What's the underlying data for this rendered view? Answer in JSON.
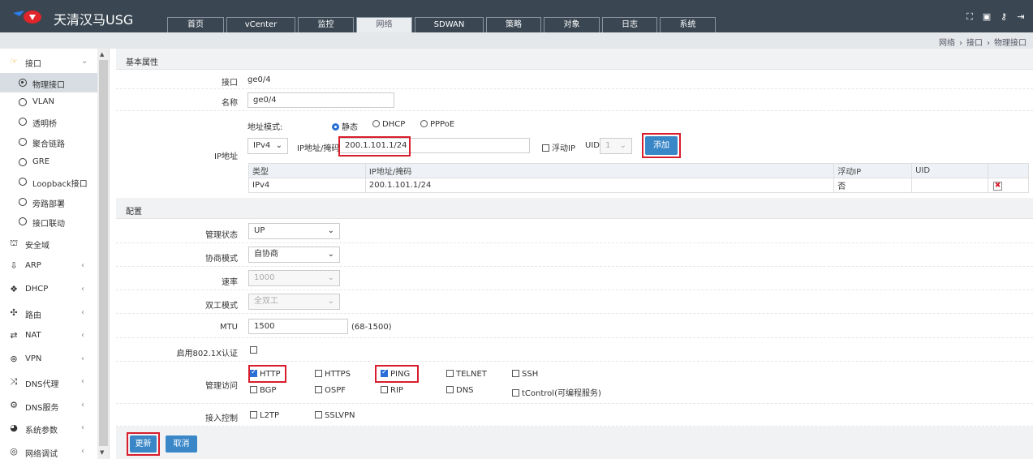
{
  "app": {
    "title": "天清汉马USG"
  },
  "main_tabs": [
    "首页",
    "vCenter",
    "监控",
    "网络",
    "SDWAN",
    "策略",
    "对象",
    "日志",
    "系统"
  ],
  "active_tab": "网络",
  "breadcrumb": [
    "网络",
    "接口",
    "物理接口"
  ],
  "sidebar": {
    "interface_group": "接口",
    "sub_items": [
      "物理接口",
      "VLAN",
      "透明桥",
      "聚合链路",
      "GRE",
      "Loopback接口",
      "旁路部署",
      "接口联动"
    ],
    "groups": [
      "安全域",
      "ARP",
      "DHCP",
      "路由",
      "NAT",
      "VPN",
      "DNS代理",
      "DNS服务",
      "系统参数",
      "网络调试"
    ]
  },
  "basic": {
    "section_title": "基本属性",
    "interface_label": "接口",
    "interface_value": "ge0/4",
    "name_label": "名称",
    "name_value": "ge0/4",
    "ip_label": "IP地址",
    "addr_mode_label": "地址模式:",
    "modes": [
      "静态",
      "DHCP",
      "PPPoE"
    ],
    "ip_version": "IPv4",
    "ip_mask_label": "IP地址/掩码",
    "ip_value": "200.1.101.1/24",
    "float_ip_label": "浮动IP",
    "uid_label": "UID",
    "uid_value": "1",
    "add_button": "添加",
    "table_headers": [
      "类型",
      "IP地址/掩码",
      "浮动IP",
      "UID",
      ""
    ],
    "table_rows": [
      [
        "IPv4",
        "200.1.101.1/24",
        "否",
        ""
      ]
    ]
  },
  "config": {
    "section_title": "配置",
    "admin_status_label": "管理状态",
    "admin_status_value": "UP",
    "negotiation_label": "协商模式",
    "negotiation_value": "自协商",
    "speed_label": "速率",
    "speed_value": "1000",
    "duplex_label": "双工模式",
    "duplex_value": "全双工",
    "mtu_label": "MTU",
    "mtu_value": "1500",
    "mtu_range": "(68-1500)",
    "dot1x_label": "启用802.1X认证",
    "mgmt_label": "管理访问",
    "mgmt_row1": [
      "HTTP",
      "HTTPS",
      "PING",
      "TELNET",
      "SSH"
    ],
    "mgmt_row2": [
      "BGP",
      "OSPF",
      "RIP",
      "DNS",
      "tControl(可编程服务)"
    ],
    "access_label": "接入控制",
    "access_items": [
      "L2TP",
      "SSLVPN"
    ]
  },
  "actions": {
    "update": "更新",
    "cancel": "取消"
  },
  "colors": {
    "header": "#3a4753",
    "button": "#3a87c8",
    "highlight": "#d81e2c"
  }
}
